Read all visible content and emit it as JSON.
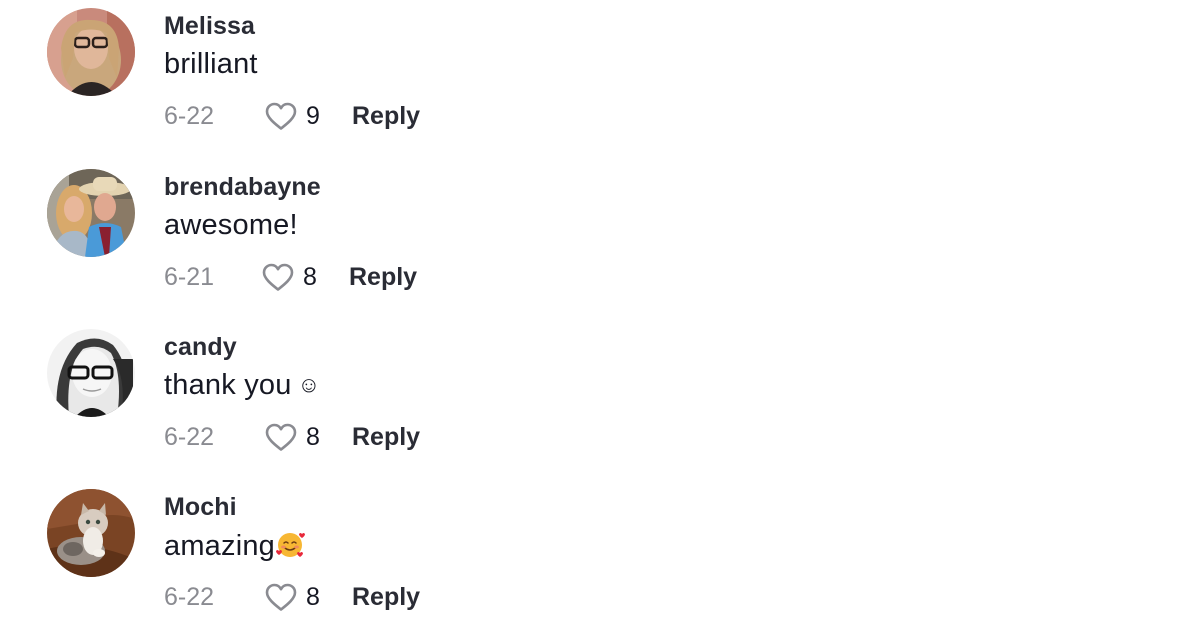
{
  "comments": [
    {
      "username": "Melissa",
      "text": "brilliant",
      "emoji": "",
      "date": "6-22",
      "likes": "9",
      "reply_label": "Reply",
      "avatar": "avatar-woman-glasses"
    },
    {
      "username": "brendabayne",
      "text": "awesome!",
      "emoji": "",
      "date": "6-21",
      "likes": "8",
      "reply_label": "Reply",
      "avatar": "avatar-couple-cowboy-hat"
    },
    {
      "username": "candy",
      "text": "thank you",
      "emoji": "☺",
      "date": "6-22",
      "likes": "8",
      "reply_label": "Reply",
      "avatar": "avatar-woman-bw-glasses"
    },
    {
      "username": "Mochi",
      "text": "amazing",
      "emoji": "🥰",
      "date": "6-22",
      "likes": "8",
      "reply_label": "Reply",
      "avatar": "avatar-kitten"
    }
  ],
  "icons": {
    "like": "heart-outline-icon"
  },
  "colors": {
    "text_primary": "#161823",
    "text_secondary": "#8a8b91",
    "heart_outline": "#8a8b91"
  }
}
